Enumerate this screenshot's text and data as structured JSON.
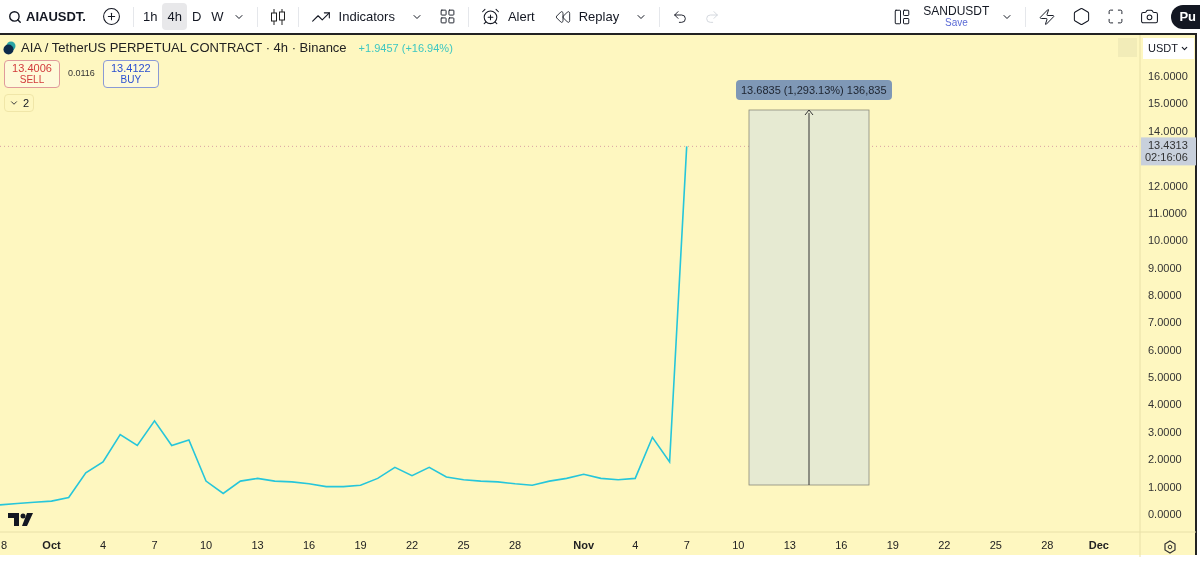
{
  "toolbar": {
    "symbol": "AIAUSDT.",
    "intervals": [
      {
        "label": "1h",
        "selected": false
      },
      {
        "label": "4h",
        "selected": true
      },
      {
        "label": "D",
        "selected": false
      },
      {
        "label": "W",
        "selected": false
      }
    ],
    "indicators": "Indicators",
    "alert": "Alert",
    "replay": "Replay",
    "redo_disabled": true,
    "layout": {
      "name": "SANDUSDT",
      "save": "Save"
    },
    "publish": "Pu"
  },
  "legend": {
    "title": "AIA / TetherUS PERPETUAL CONTRACT · 4h · Binance",
    "change": "+1.9457 (+16.94%)",
    "sell": {
      "price": "13.4006",
      "label": "SELL"
    },
    "spread": "0.0116",
    "buy": {
      "price": "13.4122",
      "label": "BUY"
    },
    "indicators_count": "2"
  },
  "price_axis": {
    "currency": "USDT",
    "last_price": "13.4313",
    "countdown": "02:16:06"
  },
  "range_measure": {
    "label": "13.6835 (1,293.13%) 136,835"
  },
  "chart_data": {
    "type": "line",
    "categories": [
      "8",
      null,
      null,
      "Oct",
      null,
      null,
      "4",
      null,
      null,
      "7",
      null,
      null,
      "10",
      null,
      null,
      "13",
      null,
      null,
      "16",
      null,
      null,
      "19",
      null,
      null,
      "22",
      null,
      null,
      "25",
      null,
      null,
      "28",
      null,
      null,
      null,
      "Nov",
      null,
      null,
      "4",
      null,
      null,
      "7",
      null,
      null,
      "10",
      null,
      null,
      "13",
      null,
      null,
      "16",
      null,
      null,
      "19",
      null,
      null,
      "22",
      null,
      null,
      "25",
      null,
      null,
      "28",
      null,
      null,
      "Dec",
      null,
      null
    ],
    "series": [
      {
        "color": "#26c6da",
        "values": [
          0.33,
          0.38,
          0.43,
          0.47,
          0.6,
          1.5,
          1.9,
          2.9,
          2.5,
          3.4,
          2.5,
          2.7,
          1.2,
          0.75,
          1.2,
          1.3,
          1.2,
          1.17,
          1.1,
          1.0,
          1.0,
          1.05,
          1.3,
          1.7,
          1.4,
          1.7,
          1.35,
          1.25,
          1.2,
          1.17,
          1.1,
          1.05,
          1.2,
          1.3,
          1.45,
          1.3,
          1.25,
          1.3,
          2.8,
          1.9,
          13.43,
          null,
          null,
          null,
          null,
          null,
          null,
          null,
          null,
          null,
          null,
          null,
          null,
          null,
          null,
          null,
          null,
          null,
          null,
          null,
          null,
          null,
          null,
          null,
          null,
          null,
          null
        ]
      }
    ],
    "ref_lines": [
      {
        "axis": "y",
        "value": 13.4313
      }
    ],
    "ylim": [
      -0.66,
      17.5
    ],
    "yticks": [
      {
        "value": 0,
        "label": "0.0000"
      },
      {
        "value": 1,
        "label": "1.0000"
      },
      {
        "value": 2,
        "label": "2.0000"
      },
      {
        "value": 3,
        "label": "3.0000"
      },
      {
        "value": 4,
        "label": "4.0000"
      },
      {
        "value": 5,
        "label": "5.0000"
      },
      {
        "value": 6,
        "label": "6.0000"
      },
      {
        "value": 7,
        "label": "7.0000"
      },
      {
        "value": 8,
        "label": "8.0000"
      },
      {
        "value": 9,
        "label": "9.0000"
      },
      {
        "value": 10,
        "label": "10.0000"
      },
      {
        "value": 11,
        "label": "11.0000"
      },
      {
        "value": 12,
        "label": "12.0000"
      },
      {
        "value": 14,
        "label": "14.0000"
      },
      {
        "value": 15,
        "label": "15.0000"
      },
      {
        "value": 16,
        "label": "16.0000"
      }
    ]
  }
}
